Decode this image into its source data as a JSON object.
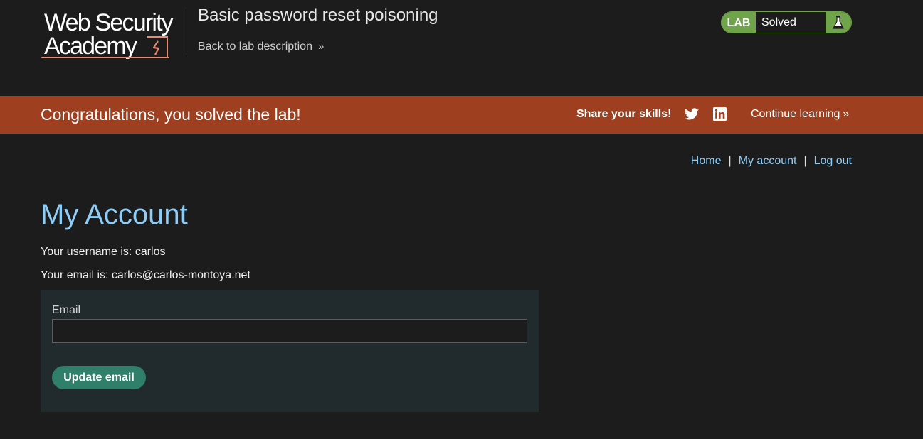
{
  "header": {
    "logo_line1": "Web Security",
    "logo_line2": "Academy",
    "lab_title": "Basic password reset poisoning",
    "back_link": "Back to lab description",
    "lab_badge": {
      "label": "LAB",
      "status": "Solved",
      "icon": "flask-icon"
    }
  },
  "banner": {
    "message": "Congratulations, you solved the lab!",
    "share_label": "Share your skills!",
    "share_icons": [
      "twitter-icon",
      "linkedin-icon"
    ],
    "continue_link": "Continue learning"
  },
  "nav": {
    "home": "Home",
    "separator": "|",
    "my_account": "My account",
    "log_out": "Log out"
  },
  "main": {
    "title": "My Account",
    "username_line": "Your username is: carlos",
    "email_line": "Your email is: carlos@carlos-montoya.net",
    "form": {
      "email_label": "Email",
      "email_value": "",
      "submit_label": "Update email"
    }
  },
  "colors": {
    "background": "#1c1c1c",
    "banner": "#9e3f1f",
    "link": "#8ecdf7",
    "lab_badge_green": "#70a44a",
    "button": "#2f7f6a",
    "form_panel": "#212a2d",
    "logo_accent": "#e98a72"
  }
}
